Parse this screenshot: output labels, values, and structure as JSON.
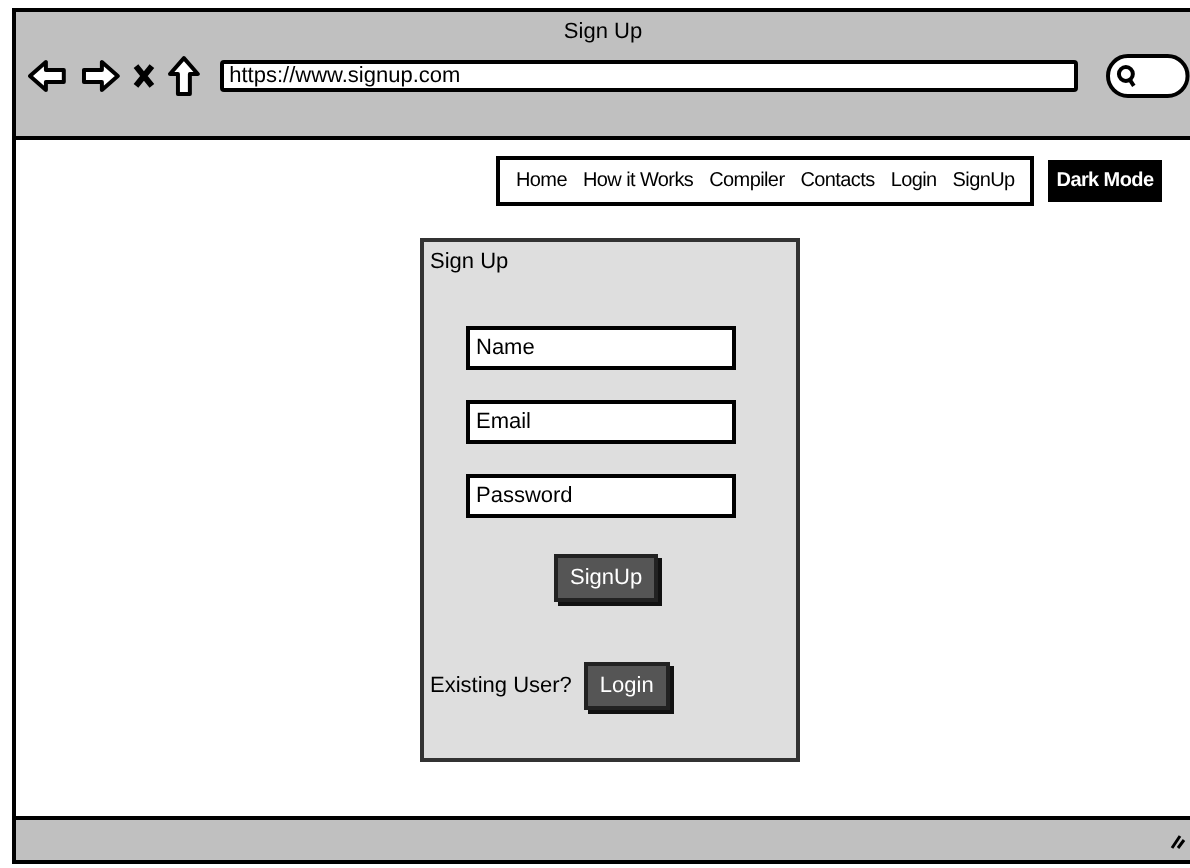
{
  "window": {
    "title": "Sign Up",
    "url": "https://www.signup.com"
  },
  "nav": {
    "items": [
      {
        "label": "Home"
      },
      {
        "label": "How it Works"
      },
      {
        "label": "Compiler"
      },
      {
        "label": "Contacts"
      },
      {
        "label": "Login"
      },
      {
        "label": "SignUp"
      }
    ],
    "dark_mode_button": "Dark Mode"
  },
  "form": {
    "title": "Sign Up",
    "fields": [
      {
        "placeholder": "Name"
      },
      {
        "placeholder": "Email"
      },
      {
        "placeholder": "Password"
      }
    ],
    "submit_button": "SignUp",
    "existing_user_label": "Existing User?",
    "login_button": "Login"
  }
}
